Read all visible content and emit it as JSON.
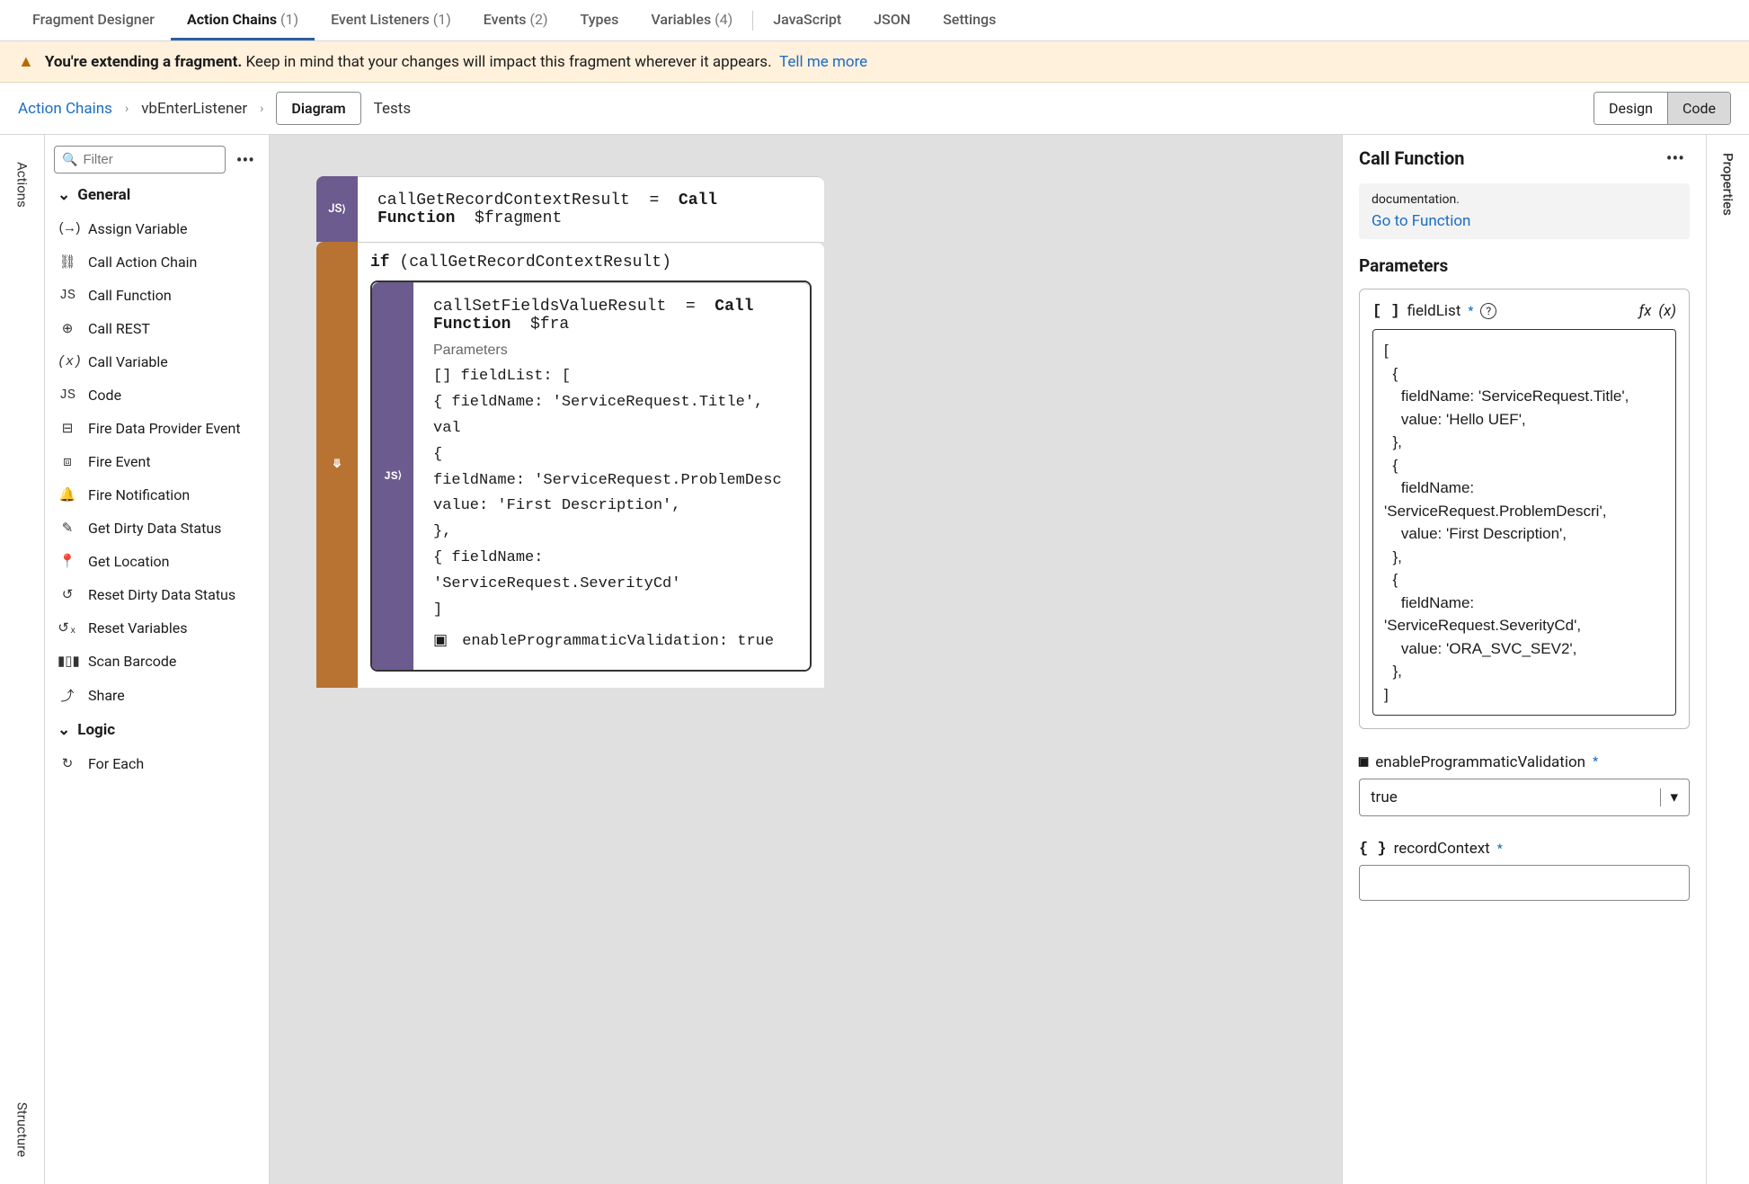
{
  "tabs": {
    "items": [
      {
        "label": "Fragment Designer",
        "count": ""
      },
      {
        "label": "Action Chains",
        "count": "(1)"
      },
      {
        "label": "Event Listeners",
        "count": "(1)"
      },
      {
        "label": "Events",
        "count": "(2)"
      },
      {
        "label": "Types",
        "count": ""
      },
      {
        "label": "Variables",
        "count": "(4)"
      },
      {
        "label": "JavaScript",
        "count": ""
      },
      {
        "label": "JSON",
        "count": ""
      },
      {
        "label": "Settings",
        "count": ""
      }
    ],
    "active_index": 1
  },
  "banner": {
    "bold": "You're extending a fragment.",
    "text": "Keep in mind that your changes will impact this fragment wherever it appears.",
    "link": "Tell me more"
  },
  "breadcrumb": {
    "root": "Action Chains",
    "current": "vbEnterListener",
    "view_toggle": [
      "Diagram",
      "Tests"
    ],
    "mode_toggle": [
      "Design",
      "Code"
    ]
  },
  "left_rail": {
    "tabs": [
      "Actions",
      "Structure"
    ]
  },
  "actions_panel": {
    "filter_placeholder": "Filter",
    "sections": [
      {
        "name": "General",
        "items": [
          "Assign Variable",
          "Call Action Chain",
          "Call Function",
          "Call REST",
          "Call Variable",
          "Code",
          "Fire Data Provider Event",
          "Fire Event",
          "Fire Notification",
          "Get Dirty Data Status",
          "Get Location",
          "Reset Dirty Data Status",
          "Reset Variables",
          "Scan Barcode",
          "Share"
        ]
      },
      {
        "name": "Logic",
        "items": [
          "For Each"
        ]
      }
    ]
  },
  "canvas": {
    "node1": {
      "var": "callGetRecordContextResult",
      "eq": "=",
      "fn": "Call Function",
      "arg": "$fragment"
    },
    "node2": {
      "if_kw": "if",
      "cond": "(callGetRecordContextResult)"
    },
    "node3": {
      "var": "callSetFieldsValueResult",
      "eq": "=",
      "fn": "Call Function",
      "arg": "$fra",
      "params_label": "Parameters",
      "lines": [
        "[]  fieldList: [",
        "      { fieldName: 'ServiceRequest.Title', val",
        "      {",
        "        fieldName: 'ServiceRequest.ProblemDesc",
        "        value: 'First Description',",
        "      },",
        "      { fieldName: 'ServiceRequest.SeverityCd'",
        "    ]"
      ],
      "enable_line": "enableProgrammaticValidation: true"
    }
  },
  "properties": {
    "title": "Call Function",
    "doc_text": "documentation.",
    "doc_link": "Go to Function",
    "section": "Parameters",
    "param1": {
      "type": "[ ]",
      "name": "fieldList",
      "json": "[\n  {\n    fieldName: 'ServiceRequest.Title',\n    value: 'Hello UEF',\n  },\n  {\n    fieldName:\n'ServiceRequest.ProblemDescri',\n    value: 'First Description',\n  },\n  {\n    fieldName:\n'ServiceRequest.SeverityCd',\n    value: 'ORA_SVC_SEV2',\n  },\n]"
    },
    "param2": {
      "name": "enableProgrammaticValidation",
      "value": "true"
    },
    "param3": {
      "type": "{ }",
      "name": "recordContext"
    }
  },
  "right_rail": {
    "tabs": [
      "Properties"
    ]
  }
}
